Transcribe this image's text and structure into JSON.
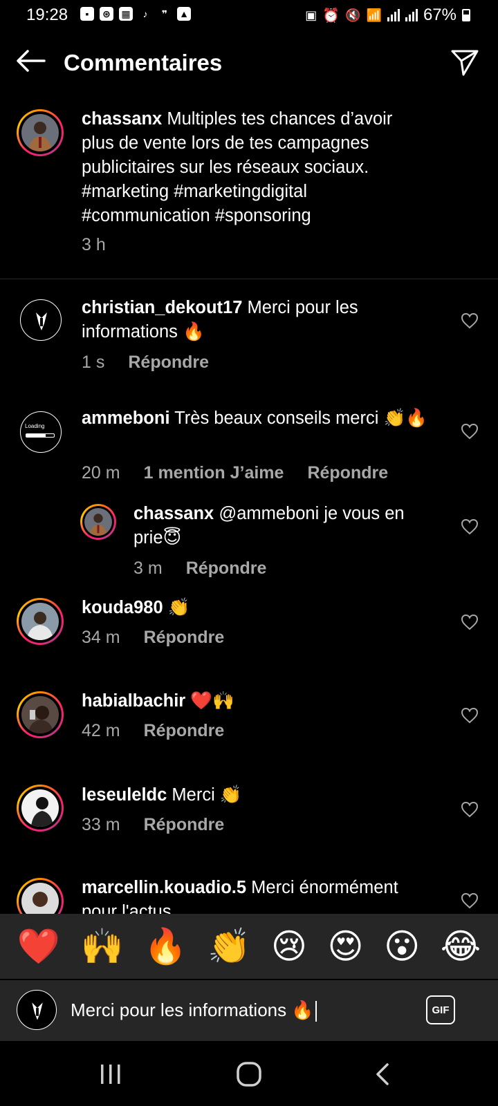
{
  "status": {
    "time": "19:28",
    "battery": "67%"
  },
  "header": {
    "title": "Commentaires"
  },
  "caption": {
    "user": "chassanx",
    "text": " Multiples tes chances d’avoir plus de vente lors de tes campagnes publicitaires sur les réseaux sociaux. #marketing #marketingdigital #communication #sponsoring",
    "time": "3 h"
  },
  "comments": [
    {
      "user": "christian_dekout17",
      "text": " Merci pour les informations 🔥",
      "time": "1 s",
      "reply": "Répondre"
    },
    {
      "user": "ammeboni",
      "text": " Très beaux conseils merci 👏🔥",
      "time": "20 m",
      "likes": "1 mention J’aime",
      "reply": "Répondre"
    },
    {
      "user": "chassanx",
      "text": " @ammeboni je vous en prie😇",
      "time": "3 m",
      "reply": "Répondre"
    },
    {
      "user": "kouda980",
      "text": " 👏",
      "time": "34 m",
      "reply": "Répondre"
    },
    {
      "user": "habialbachir",
      "text": " ❤️🙌",
      "time": "42 m",
      "reply": "Répondre"
    },
    {
      "user": "leseuleldc",
      "text": " Merci 👏",
      "time": "33 m",
      "reply": "Répondre"
    },
    {
      "user": "marcellin.kouadio.5",
      "text": " Merci énormément pour l'actus"
    }
  ],
  "emoji_bar": [
    "❤️",
    "🙌",
    "🔥",
    "👏",
    "😢",
    "😍",
    "😮",
    "😂"
  ],
  "input": {
    "value": "Merci pour les informations 🔥",
    "gif_label": "GIF"
  },
  "colors": {
    "background": "#000000",
    "secondary_text": "#a8a8a8",
    "bar_background": "#262626"
  },
  "icons": {
    "loading_avatar_text": "Loading"
  }
}
